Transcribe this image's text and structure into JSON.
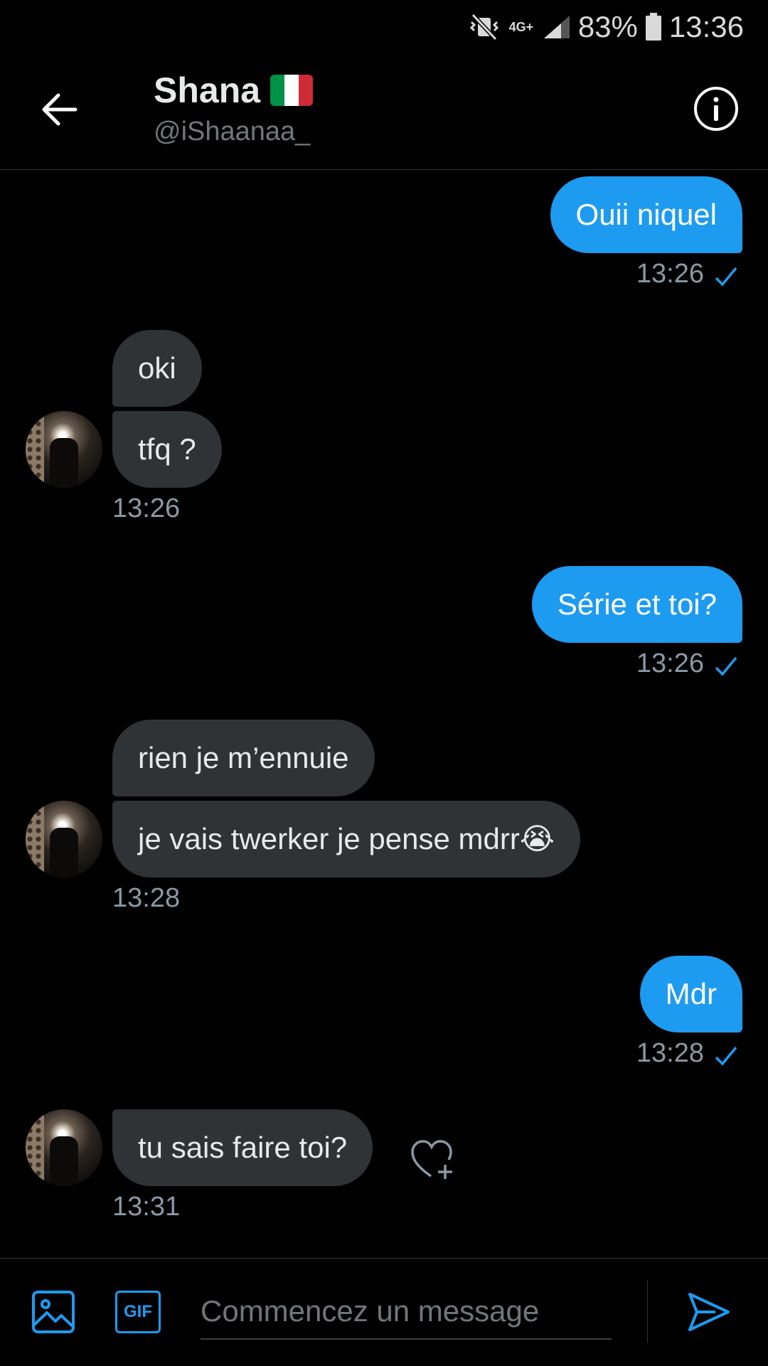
{
  "status_bar": {
    "network": "4G+",
    "battery": "83%",
    "time": "13:36"
  },
  "header": {
    "name": "Shana",
    "flag": "italy-flag",
    "handle": "@iShaanaa_",
    "back_icon": "arrow-left-icon",
    "info_icon": "info-icon"
  },
  "messages": [
    {
      "from": "me",
      "text": "Ouii niquel",
      "time": "13:26",
      "read": true
    },
    {
      "from": "them",
      "text": "oki"
    },
    {
      "from": "them",
      "text": "tfq ?",
      "time": "13:26"
    },
    {
      "from": "me",
      "text": "Série et toi?",
      "time": "13:26",
      "read": true
    },
    {
      "from": "them",
      "text": "rien je m’ennuie"
    },
    {
      "from": "them",
      "text": "je vais twerker je pense mdrr😭",
      "time": "13:28"
    },
    {
      "from": "me",
      "text": "Mdr",
      "time": "13:28",
      "read": true
    },
    {
      "from": "them",
      "text": "tu sais faire toi?",
      "time": "13:31"
    }
  ],
  "composer": {
    "placeholder": "Commencez un message",
    "gif_label": "GIF",
    "media_icon": "image-icon",
    "send_icon": "send-icon"
  },
  "colors": {
    "accent": "#1d9bf0",
    "received_bubble": "#2f3336",
    "background": "#000000"
  }
}
